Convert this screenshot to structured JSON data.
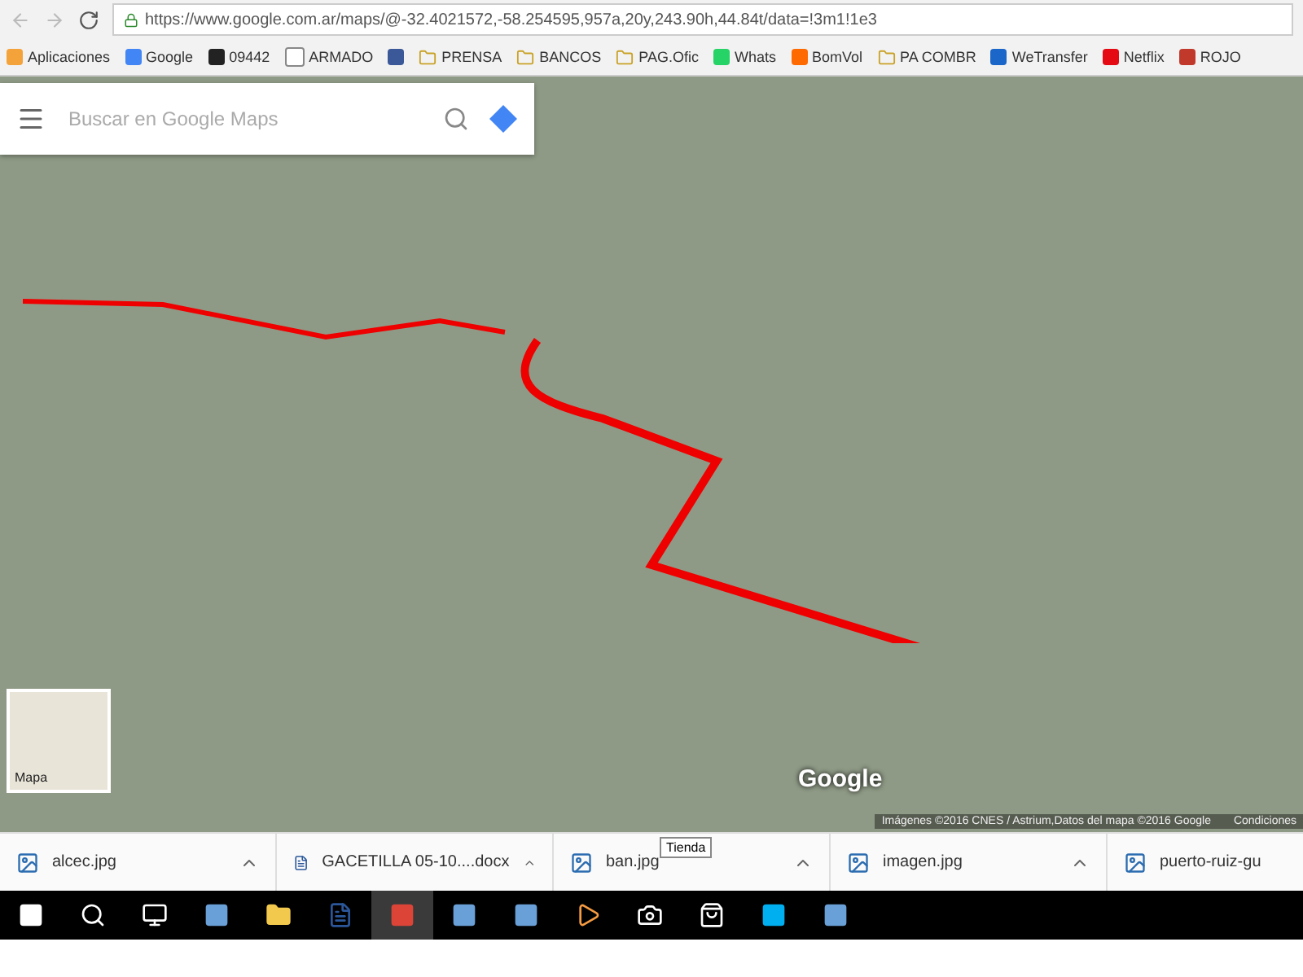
{
  "address_bar": {
    "url": "https://www.google.com.ar/maps/@-32.4021572,-58.254595,957a,20y,243.90h,44.84t/data=!3m1!1e3"
  },
  "bookmarks": [
    {
      "label": "Aplicaciones",
      "kind": "apps"
    },
    {
      "label": "Google",
      "kind": "google"
    },
    {
      "label": "09442",
      "kind": "dark"
    },
    {
      "label": "ARMADO",
      "kind": "page"
    },
    {
      "kind": "facebook"
    },
    {
      "label": "PRENSA",
      "kind": "folder"
    },
    {
      "label": "BANCOS",
      "kind": "folder"
    },
    {
      "label": "PAG.Ofic",
      "kind": "folder"
    },
    {
      "label": "Whats",
      "kind": "whatsapp"
    },
    {
      "label": "BomVol",
      "kind": "orange"
    },
    {
      "label": "PA COMBR",
      "kind": "folder"
    },
    {
      "label": "WeTransfer",
      "kind": "we"
    },
    {
      "label": "Netflix",
      "kind": "netflix"
    },
    {
      "label": "ROJO",
      "kind": "shield"
    }
  ],
  "map": {
    "search": {
      "placeholder": "Buscar en Google Maps"
    },
    "layer_switch": {
      "label": "Mapa"
    },
    "logo": "Google",
    "attribution": "Imágenes ©2016 CNES / Astrium,Datos del mapa ©2016 Google",
    "terms": "Condiciones"
  },
  "downloads": [
    {
      "name": "alcec.jpg",
      "kind": "image"
    },
    {
      "name": "GACETILLA 05-10....docx",
      "kind": "doc"
    },
    {
      "name": "ban.jpg",
      "kind": "image"
    },
    {
      "name": "imagen.jpg",
      "kind": "image"
    },
    {
      "name": "puerto-ruiz-gu",
      "kind": "image"
    }
  ],
  "tooltip": "Tienda",
  "taskbar": [
    {
      "kind": "windows"
    },
    {
      "kind": "search"
    },
    {
      "kind": "taskview"
    },
    {
      "kind": "app"
    },
    {
      "kind": "folder"
    },
    {
      "kind": "word"
    },
    {
      "kind": "chrome",
      "selected": true
    },
    {
      "kind": "app"
    },
    {
      "kind": "app"
    },
    {
      "kind": "media"
    },
    {
      "kind": "camera"
    },
    {
      "kind": "store"
    },
    {
      "kind": "skype"
    },
    {
      "kind": "app"
    }
  ]
}
